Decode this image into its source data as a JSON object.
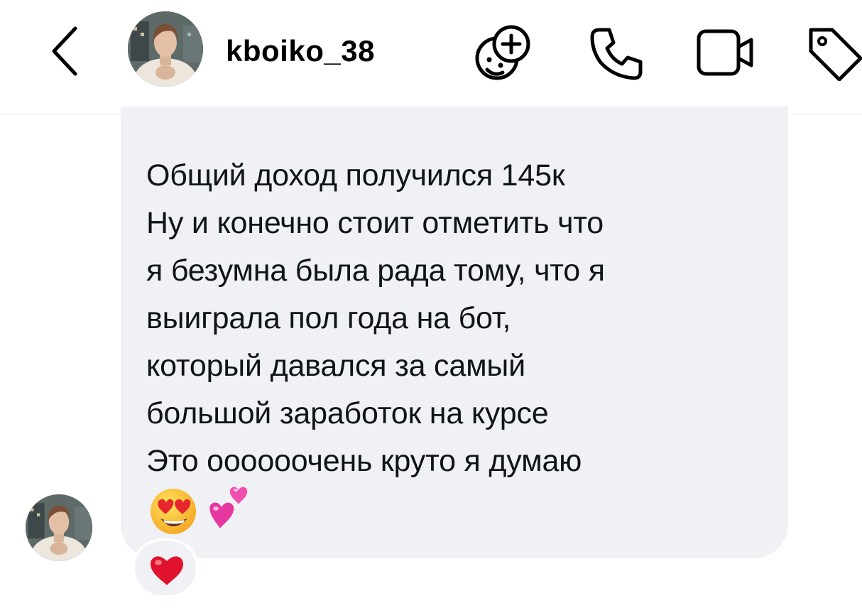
{
  "header": {
    "username": "kboiko_38",
    "icons": [
      "back-chevron-icon",
      "add-sticker-icon",
      "phone-call-icon",
      "video-call-icon",
      "tag-icon"
    ]
  },
  "message": {
    "text": "Общий доход получился 145к\nНу и конечно стоит отметить что\nя безумна была рада тому, что я\nвыиграла пол года на бот,\nкоторый давался за самый\nбольшой заработок на курсе\nЭто оооооочень круто я думаю",
    "emojis": [
      "heart-eyes-emoji",
      "two-hearts-emoji"
    ],
    "reaction": "red-heart-emoji"
  },
  "colors": {
    "bubble": "#eff1f5",
    "text": "#0f1419",
    "heart": "#e0122d",
    "pink": "#e5379d"
  }
}
